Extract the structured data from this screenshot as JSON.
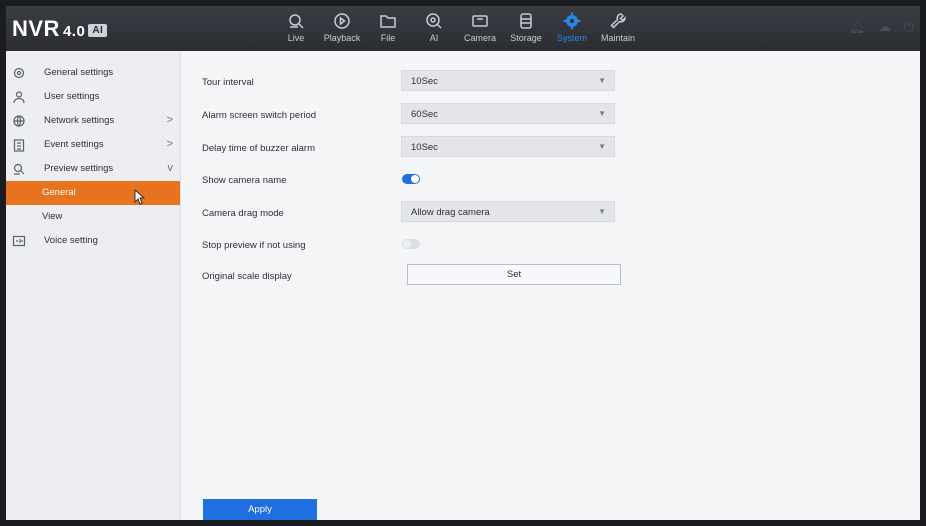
{
  "app": {
    "logo_text": "NVR",
    "logo_version": "4.0",
    "logo_badge": "AI"
  },
  "nav": [
    {
      "label": "Live",
      "icon": "live-icon"
    },
    {
      "label": "Playback",
      "icon": "playback-icon"
    },
    {
      "label": "File",
      "icon": "folder-icon"
    },
    {
      "label": "AI",
      "icon": "ai-icon"
    },
    {
      "label": "Camera",
      "icon": "camera-icon"
    },
    {
      "label": "Storage",
      "icon": "storage-icon"
    },
    {
      "label": "System",
      "icon": "gear-icon",
      "active": true
    },
    {
      "label": "Maintain",
      "icon": "wrench-icon"
    }
  ],
  "sidebar": {
    "items": [
      {
        "label": "General settings",
        "icon": "gear-icon"
      },
      {
        "label": "User settings",
        "icon": "user-icon"
      },
      {
        "label": "Network settings",
        "icon": "globe-icon",
        "chevron": ">"
      },
      {
        "label": "Event settings",
        "icon": "clipboard-icon",
        "chevron": ">"
      },
      {
        "label": "Preview settings",
        "icon": "preview-icon",
        "chevron": "v"
      },
      {
        "label": "General",
        "active": true
      },
      {
        "label": "View"
      },
      {
        "label": "Voice setting",
        "icon": "voice-icon"
      }
    ]
  },
  "settings": {
    "tour_interval": {
      "label": "Tour interval",
      "value": "10Sec"
    },
    "alarm_switch": {
      "label": "Alarm screen switch period",
      "value": "60Sec"
    },
    "buzzer_delay": {
      "label": "Delay time of buzzer alarm",
      "value": "10Sec"
    },
    "show_camera_name": {
      "label": "Show camera name",
      "enabled": true
    },
    "drag_mode": {
      "label": "Camera drag mode",
      "value": "Allow drag camera"
    },
    "stop_preview": {
      "label": "Stop preview if not using",
      "enabled": false
    },
    "original_scale": {
      "label": "Original scale display",
      "button": "Set"
    }
  },
  "actions": {
    "apply": "Apply"
  },
  "colors": {
    "accent": "#1f6fe0",
    "sidebar_active": "#e8731e",
    "nav_active": "#2a86e6"
  }
}
